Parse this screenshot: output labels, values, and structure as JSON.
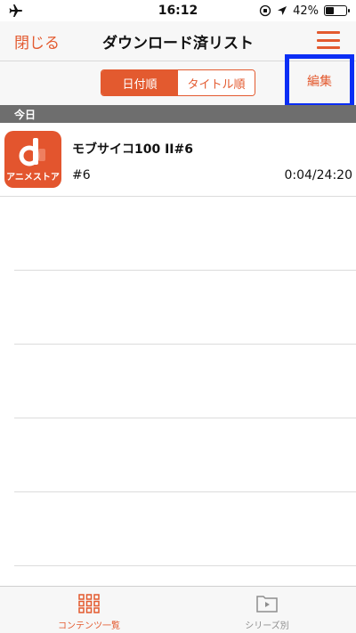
{
  "status_bar": {
    "time": "16:12",
    "battery_percent": "42%",
    "battery_level": 0.42
  },
  "nav": {
    "close_label": "閉じる",
    "title": "ダウンロード済リスト",
    "menu_icon": "hamburger-menu-icon"
  },
  "sort": {
    "options": [
      "日付順",
      "タイトル順"
    ],
    "selected": "日付順",
    "edit_label": "編集"
  },
  "section": {
    "header": "今日"
  },
  "items": [
    {
      "thumb_label": "アニメストア",
      "title": "モブサイコ100 II#6",
      "episode": "#6",
      "time": "0:04/24:20"
    }
  ],
  "tabs": [
    {
      "label": "コンテンツ一覧",
      "icon": "grid-icon",
      "active": true
    },
    {
      "label": "シリーズ別",
      "icon": "folder-play-icon",
      "active": false
    }
  ],
  "colors": {
    "accent": "#e35a2f",
    "highlight_box": "#0b2ef5",
    "section_header_bg": "#6e6e6e"
  }
}
